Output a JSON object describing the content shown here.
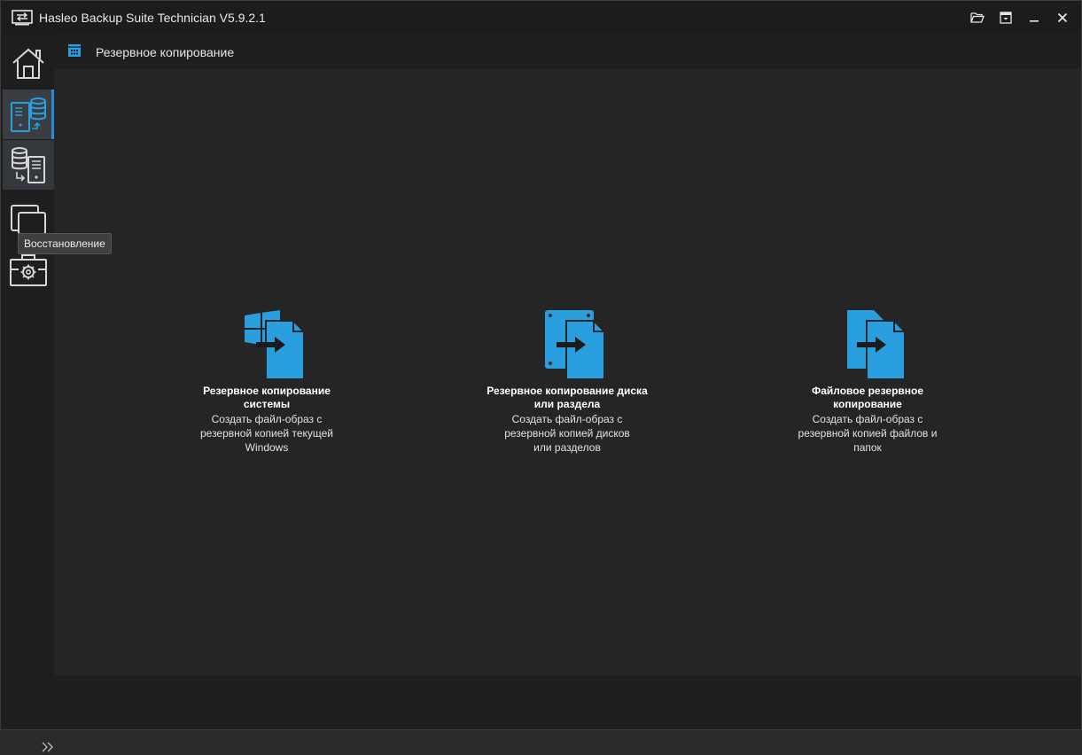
{
  "window": {
    "title": "Hasleo Backup Suite Technician V5.9.2.1"
  },
  "sidebar": {
    "items": [
      {
        "name": "home",
        "icon": "home-icon"
      },
      {
        "name": "backup",
        "icon": "backup-icon",
        "active": true
      },
      {
        "name": "restore",
        "icon": "restore-icon"
      },
      {
        "name": "clone",
        "icon": "clone-icon"
      },
      {
        "name": "tools",
        "icon": "tools-icon"
      }
    ],
    "tooltip": "Восстановление"
  },
  "header": {
    "title": "Резервное копирование"
  },
  "options": [
    {
      "title": "Резервное копирование системы",
      "description": "Создать файл-образ с резервной копией текущей Windows",
      "icon": "system-backup-icon"
    },
    {
      "title": "Резервное копирование диска или раздела",
      "description": "Создать файл-образ с резервной копией дисков или разделов",
      "icon": "disk-backup-icon"
    },
    {
      "title": "Файловое резервное копирование",
      "description": "Создать файл-образ с резервной копией файлов и папок",
      "icon": "file-backup-icon"
    }
  ],
  "colors": {
    "accent": "#2a9fe0",
    "background": "#252525"
  }
}
